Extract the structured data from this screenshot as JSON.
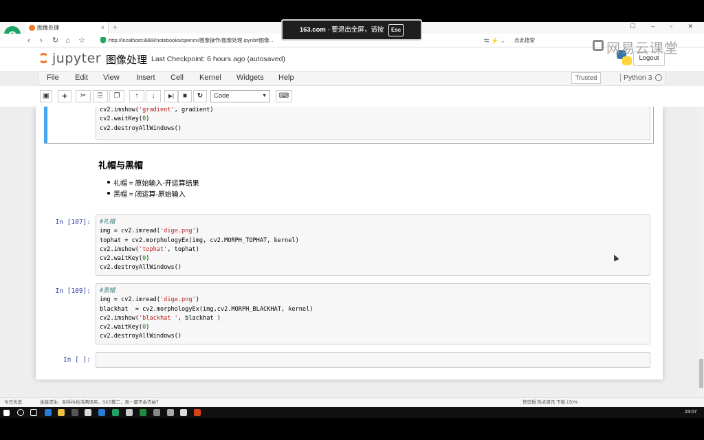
{
  "browser": {
    "tab_title": "图像处理",
    "url": "http://localhost:8888/notebooks/opencv/图像操作/图像处理.ipynb#图像...",
    "search_placeholder": "点此搜索",
    "new_tab": "+",
    "tab_close": "×",
    "nav_back": "‹",
    "nav_forward": "›",
    "nav_reload": "↻",
    "nav_home": "⌂",
    "nav_star": "☆",
    "win_controls": "☐ – ▫ ✕"
  },
  "notice": {
    "domain": "163.com",
    "text": "- 要退出全屏，请按",
    "key": "Esc"
  },
  "watermark": "网易云课堂",
  "jupyter": {
    "logo_text": "jupyter",
    "notebook_title": "图像处理",
    "checkpoint": "Last Checkpoint: 6 hours ago (autosaved)",
    "logout": "Logout",
    "menu": [
      "File",
      "Edit",
      "View",
      "Insert",
      "Cell",
      "Kernel",
      "Widgets",
      "Help"
    ],
    "trusted": "Trusted",
    "kernel_name": "Python 3",
    "cell_type": "Code",
    "toolbar": {
      "save": "💾",
      "add": "+",
      "cut": "✂",
      "copy": "⎘",
      "paste": "📋",
      "up": "↑",
      "down": "↓",
      "run": "▶|",
      "stop": "■",
      "restart": "↻",
      "keyboard": "⌨"
    }
  },
  "cells": {
    "prev_code": [
      "cv2.imshow('gradient', gradient)",
      "cv2.waitKey(0)",
      "cv2.destroyAllWindows()"
    ],
    "markdown": {
      "heading": "礼帽与黑帽",
      "items": [
        "礼帽 = 原始输入-开运算结果",
        "黑帽 = 闭运算-原始输入"
      ]
    },
    "cell107": {
      "prompt": "In [107]:",
      "lines": [
        "#礼帽",
        "img = cv2.imread('dige.png')",
        "tophat = cv2.morphologyEx(img, cv2.MORPH_TOPHAT, kernel)",
        "cv2.imshow('tophat', tophat)",
        "cv2.waitKey(0)",
        "cv2.destroyAllWindows()"
      ]
    },
    "cell109": {
      "prompt": "In [109]:",
      "lines": [
        "#黑帽",
        "img = cv2.imread('dige.png')",
        "blackhat  = cv2.morphologyEx(img,cv2.MORPH_BLACKHAT, kernel)",
        "cv2.imshow('blackhat ', blackhat )",
        "cv2.waitKey(0)",
        "cv2.destroyAllWindows()"
      ]
    },
    "empty": {
      "prompt": "In [ ]:"
    }
  },
  "statusbar": {
    "left1": "今日优选",
    "left2": "谁能求生：别手拎枪活两场吊，SKS算二，真一都不会去拍？",
    "right": "快剪辑   热点资讯   下载   150%"
  },
  "taskbar": {
    "clock": "23:07"
  }
}
